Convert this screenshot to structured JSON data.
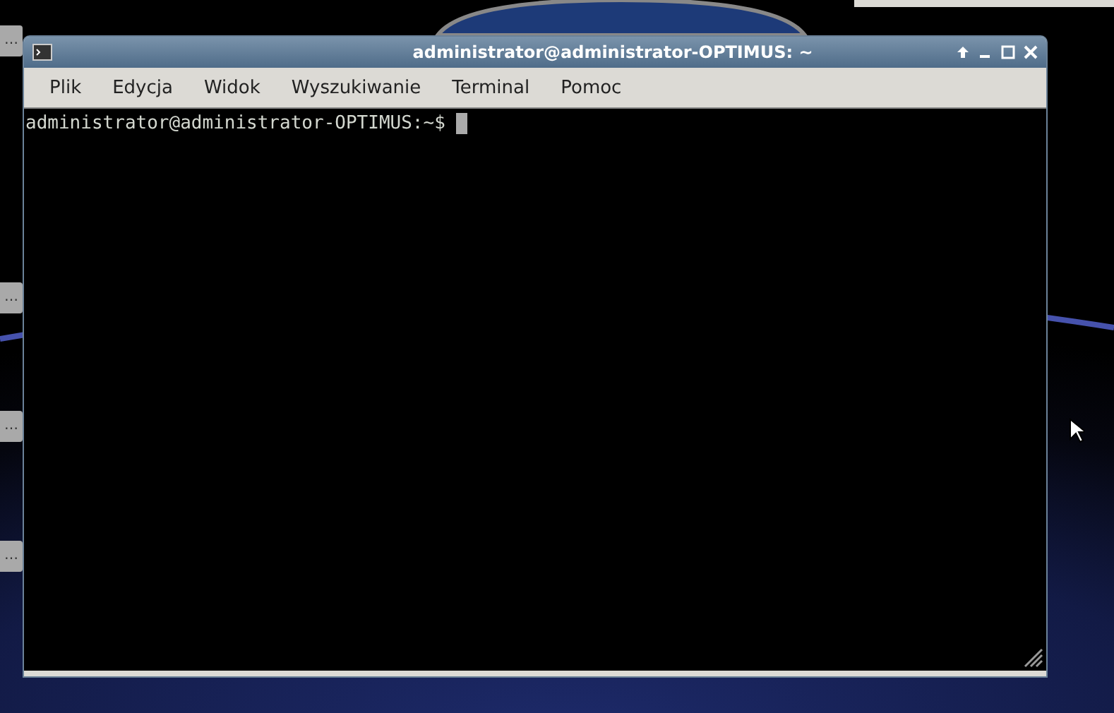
{
  "desktop": {
    "side_tabs": [
      {
        "label": "…"
      },
      {
        "label": "…"
      },
      {
        "label": "…"
      },
      {
        "label": "…"
      }
    ]
  },
  "window": {
    "title": "administrator@administrator-OPTIMUS: ~"
  },
  "menu": [
    {
      "label": "Plik"
    },
    {
      "label": "Edycja"
    },
    {
      "label": "Widok"
    },
    {
      "label": "Wyszukiwanie"
    },
    {
      "label": "Terminal"
    },
    {
      "label": "Pomoc"
    }
  ],
  "terminal": {
    "lines": [
      "administrator@administrator-OPTIMUS:~$ "
    ]
  }
}
